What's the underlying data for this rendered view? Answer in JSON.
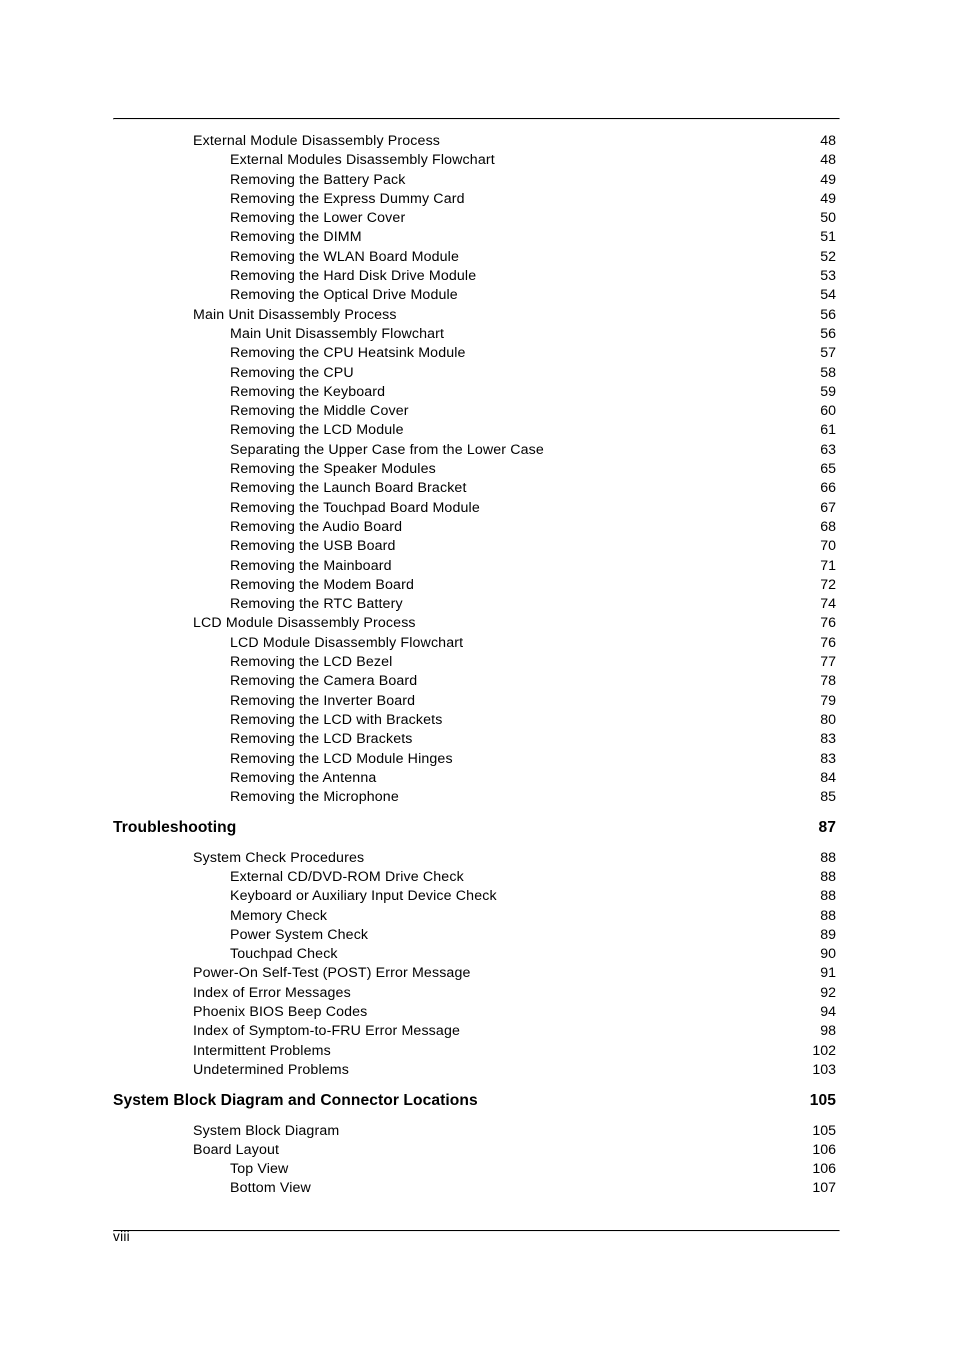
{
  "page": {
    "folio": "viii",
    "rule_color": "#000000"
  },
  "toc": {
    "entries": [
      {
        "level": 1,
        "title": "External Module Disassembly Process",
        "page": "48"
      },
      {
        "level": 2,
        "title": "External Modules Disassembly Flowchart",
        "page": "48"
      },
      {
        "level": 2,
        "title": "Removing the Battery Pack",
        "page": "49"
      },
      {
        "level": 2,
        "title": "Removing the Express Dummy Card",
        "page": "49"
      },
      {
        "level": 2,
        "title": "Removing the Lower Cover",
        "page": "50"
      },
      {
        "level": 2,
        "title": "Removing the DIMM",
        "page": "51"
      },
      {
        "level": 2,
        "title": "Removing the WLAN Board Module",
        "page": "52"
      },
      {
        "level": 2,
        "title": "Removing the Hard Disk Drive Module",
        "page": "53"
      },
      {
        "level": 2,
        "title": "Removing the Optical Drive Module",
        "page": "54"
      },
      {
        "level": 1,
        "title": "Main Unit Disassembly Process",
        "page": "56"
      },
      {
        "level": 2,
        "title": "Main Unit Disassembly Flowchart",
        "page": "56"
      },
      {
        "level": 2,
        "title": "Removing the CPU Heatsink Module",
        "page": "57"
      },
      {
        "level": 2,
        "title": "Removing the CPU",
        "page": "58"
      },
      {
        "level": 2,
        "title": "Removing the Keyboard",
        "page": "59"
      },
      {
        "level": 2,
        "title": "Removing the Middle Cover",
        "page": "60"
      },
      {
        "level": 2,
        "title": "Removing the LCD Module",
        "page": "61"
      },
      {
        "level": 2,
        "title": "Separating the Upper Case from the Lower Case",
        "page": "63"
      },
      {
        "level": 2,
        "title": "Removing the Speaker Modules",
        "page": "65"
      },
      {
        "level": 2,
        "title": "Removing the Launch Board Bracket",
        "page": "66"
      },
      {
        "level": 2,
        "title": "Removing the Touchpad Board Module",
        "page": "67"
      },
      {
        "level": 2,
        "title": "Removing the Audio Board",
        "page": "68"
      },
      {
        "level": 2,
        "title": "Removing the USB Board",
        "page": "70"
      },
      {
        "level": 2,
        "title": "Removing the Mainboard",
        "page": "71"
      },
      {
        "level": 2,
        "title": "Removing the Modem Board",
        "page": "72"
      },
      {
        "level": 2,
        "title": "Removing the RTC Battery",
        "page": "74"
      },
      {
        "level": 1,
        "title": "LCD Module Disassembly Process",
        "page": "76"
      },
      {
        "level": 2,
        "title": "LCD Module Disassembly Flowchart",
        "page": "76"
      },
      {
        "level": 2,
        "title": "Removing the LCD Bezel",
        "page": "77"
      },
      {
        "level": 2,
        "title": "Removing the Camera Board",
        "page": "78"
      },
      {
        "level": 2,
        "title": "Removing the Inverter Board",
        "page": "79"
      },
      {
        "level": 2,
        "title": "Removing the LCD with Brackets",
        "page": "80"
      },
      {
        "level": 2,
        "title": "Removing the LCD Brackets",
        "page": "83"
      },
      {
        "level": 2,
        "title": "Removing the LCD Module Hinges",
        "page": "83"
      },
      {
        "level": 2,
        "title": "Removing the Antenna",
        "page": "84"
      },
      {
        "level": 2,
        "title": "Removing the Microphone",
        "page": "85"
      },
      {
        "level": 0,
        "title": "Troubleshooting",
        "page": "87"
      },
      {
        "level": 1,
        "title": "System Check Procedures",
        "page": "88"
      },
      {
        "level": 2,
        "title": "External CD/DVD-ROM Drive Check",
        "page": "88"
      },
      {
        "level": 2,
        "title": "Keyboard or Auxiliary Input Device Check",
        "page": "88"
      },
      {
        "level": 2,
        "title": "Memory Check",
        "page": "88"
      },
      {
        "level": 2,
        "title": "Power System Check",
        "page": "89"
      },
      {
        "level": 2,
        "title": "Touchpad Check",
        "page": "90"
      },
      {
        "level": 1,
        "title": "Power-On Self-Test (POST) Error Message",
        "page": "91"
      },
      {
        "level": 1,
        "title": "Index of Error Messages",
        "page": "92"
      },
      {
        "level": 1,
        "title": "Phoenix BIOS Beep Codes",
        "page": "94"
      },
      {
        "level": 1,
        "title": "Index of Symptom-to-FRU Error Message",
        "page": "98"
      },
      {
        "level": 1,
        "title": "Intermittent Problems",
        "page": "102"
      },
      {
        "level": 1,
        "title": "Undetermined Problems",
        "page": "103"
      },
      {
        "level": 0,
        "title": "System Block Diagram and Connector Locations",
        "page": "105"
      },
      {
        "level": 1,
        "title": "System Block Diagram",
        "page": "105"
      },
      {
        "level": 1,
        "title": "Board Layout",
        "page": "106"
      },
      {
        "level": 2,
        "title": "Top View",
        "page": "106"
      },
      {
        "level": 2,
        "title": "Bottom View",
        "page": "107"
      }
    ]
  }
}
